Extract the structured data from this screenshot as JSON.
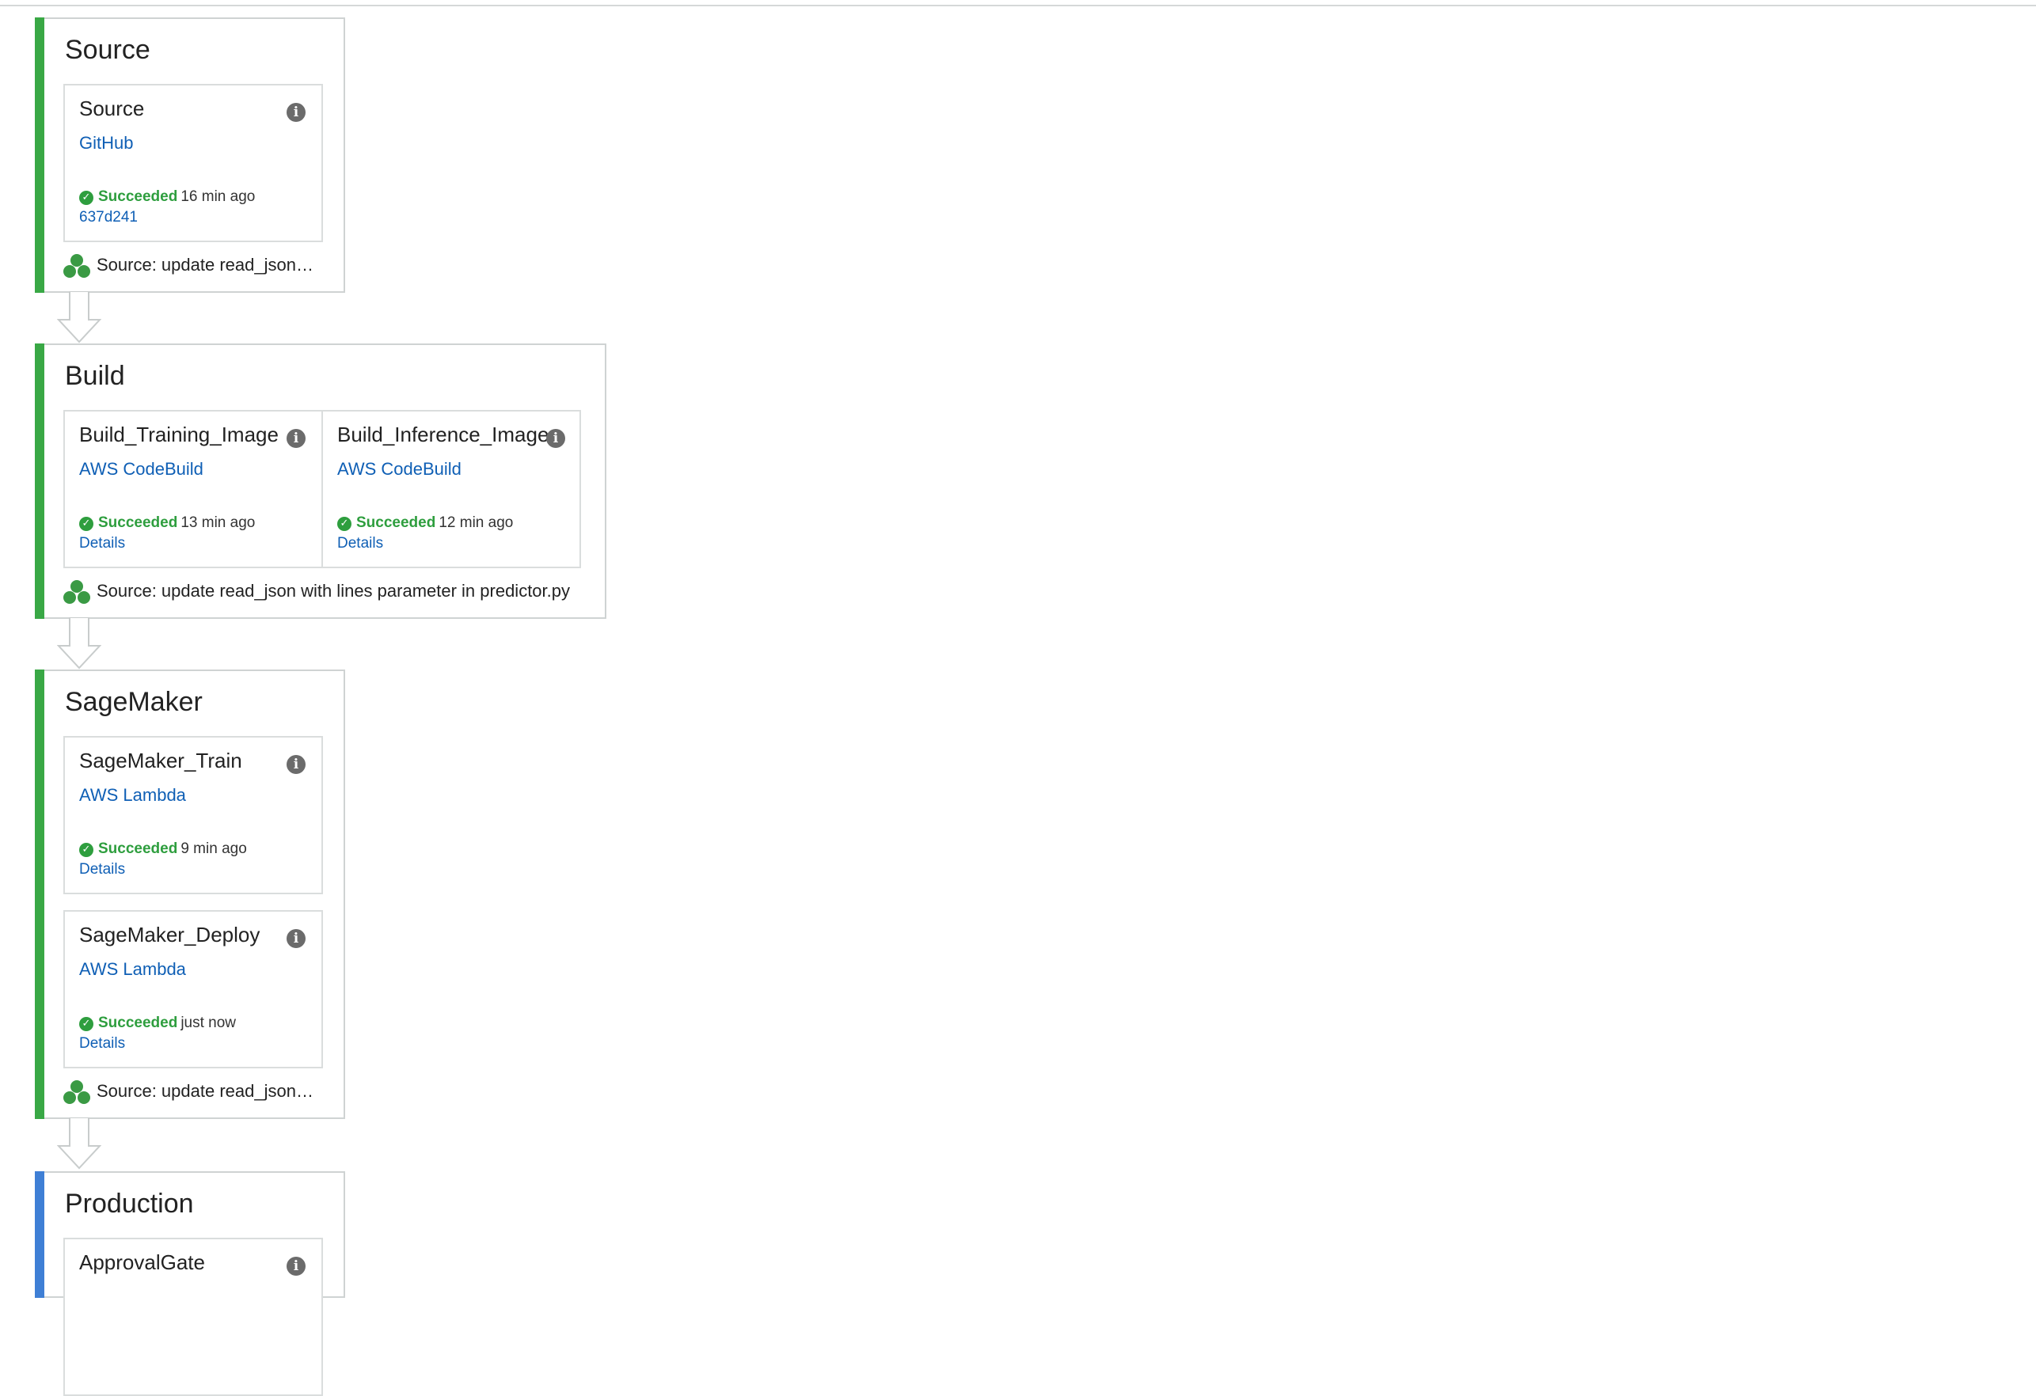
{
  "colors": {
    "succeeded_bar": "#39a845",
    "in_progress_bar": "#3f7fd5",
    "link": "#0f5fb5",
    "success_text": "#2e9e3e"
  },
  "stages": {
    "source": {
      "title": "Source",
      "commit": "Source: update read_json…",
      "actions": [
        {
          "name": "Source",
          "provider": "GitHub",
          "status": "Succeeded",
          "time": "16 min ago",
          "link": "637d241"
        }
      ]
    },
    "build": {
      "title": "Build",
      "commit": "Source: update read_json with lines parameter in predictor.py",
      "actions": [
        {
          "name": "Build_Training_Image",
          "provider": "AWS CodeBuild",
          "status": "Succeeded",
          "time": "13 min ago",
          "link": "Details"
        },
        {
          "name": "Build_Inference_Image",
          "provider": "AWS CodeBuild",
          "status": "Succeeded",
          "time": "12 min ago",
          "link": "Details"
        }
      ]
    },
    "sagemaker": {
      "title": "SageMaker",
      "commit": "Source: update read_json…",
      "actions": [
        {
          "name": "SageMaker_Train",
          "provider": "AWS Lambda",
          "status": "Succeeded",
          "time": "9 min ago",
          "link": "Details"
        },
        {
          "name": "SageMaker_Deploy",
          "provider": "AWS Lambda",
          "status": "Succeeded",
          "time": "just now",
          "link": "Details"
        }
      ]
    },
    "production": {
      "title": "Production",
      "actions": [
        {
          "name": "ApprovalGate"
        }
      ]
    }
  },
  "icons": {
    "info": "info-icon",
    "status": "check-circle-icon",
    "commit": "commit-cluster-icon",
    "transition": "down-arrow-icon"
  }
}
